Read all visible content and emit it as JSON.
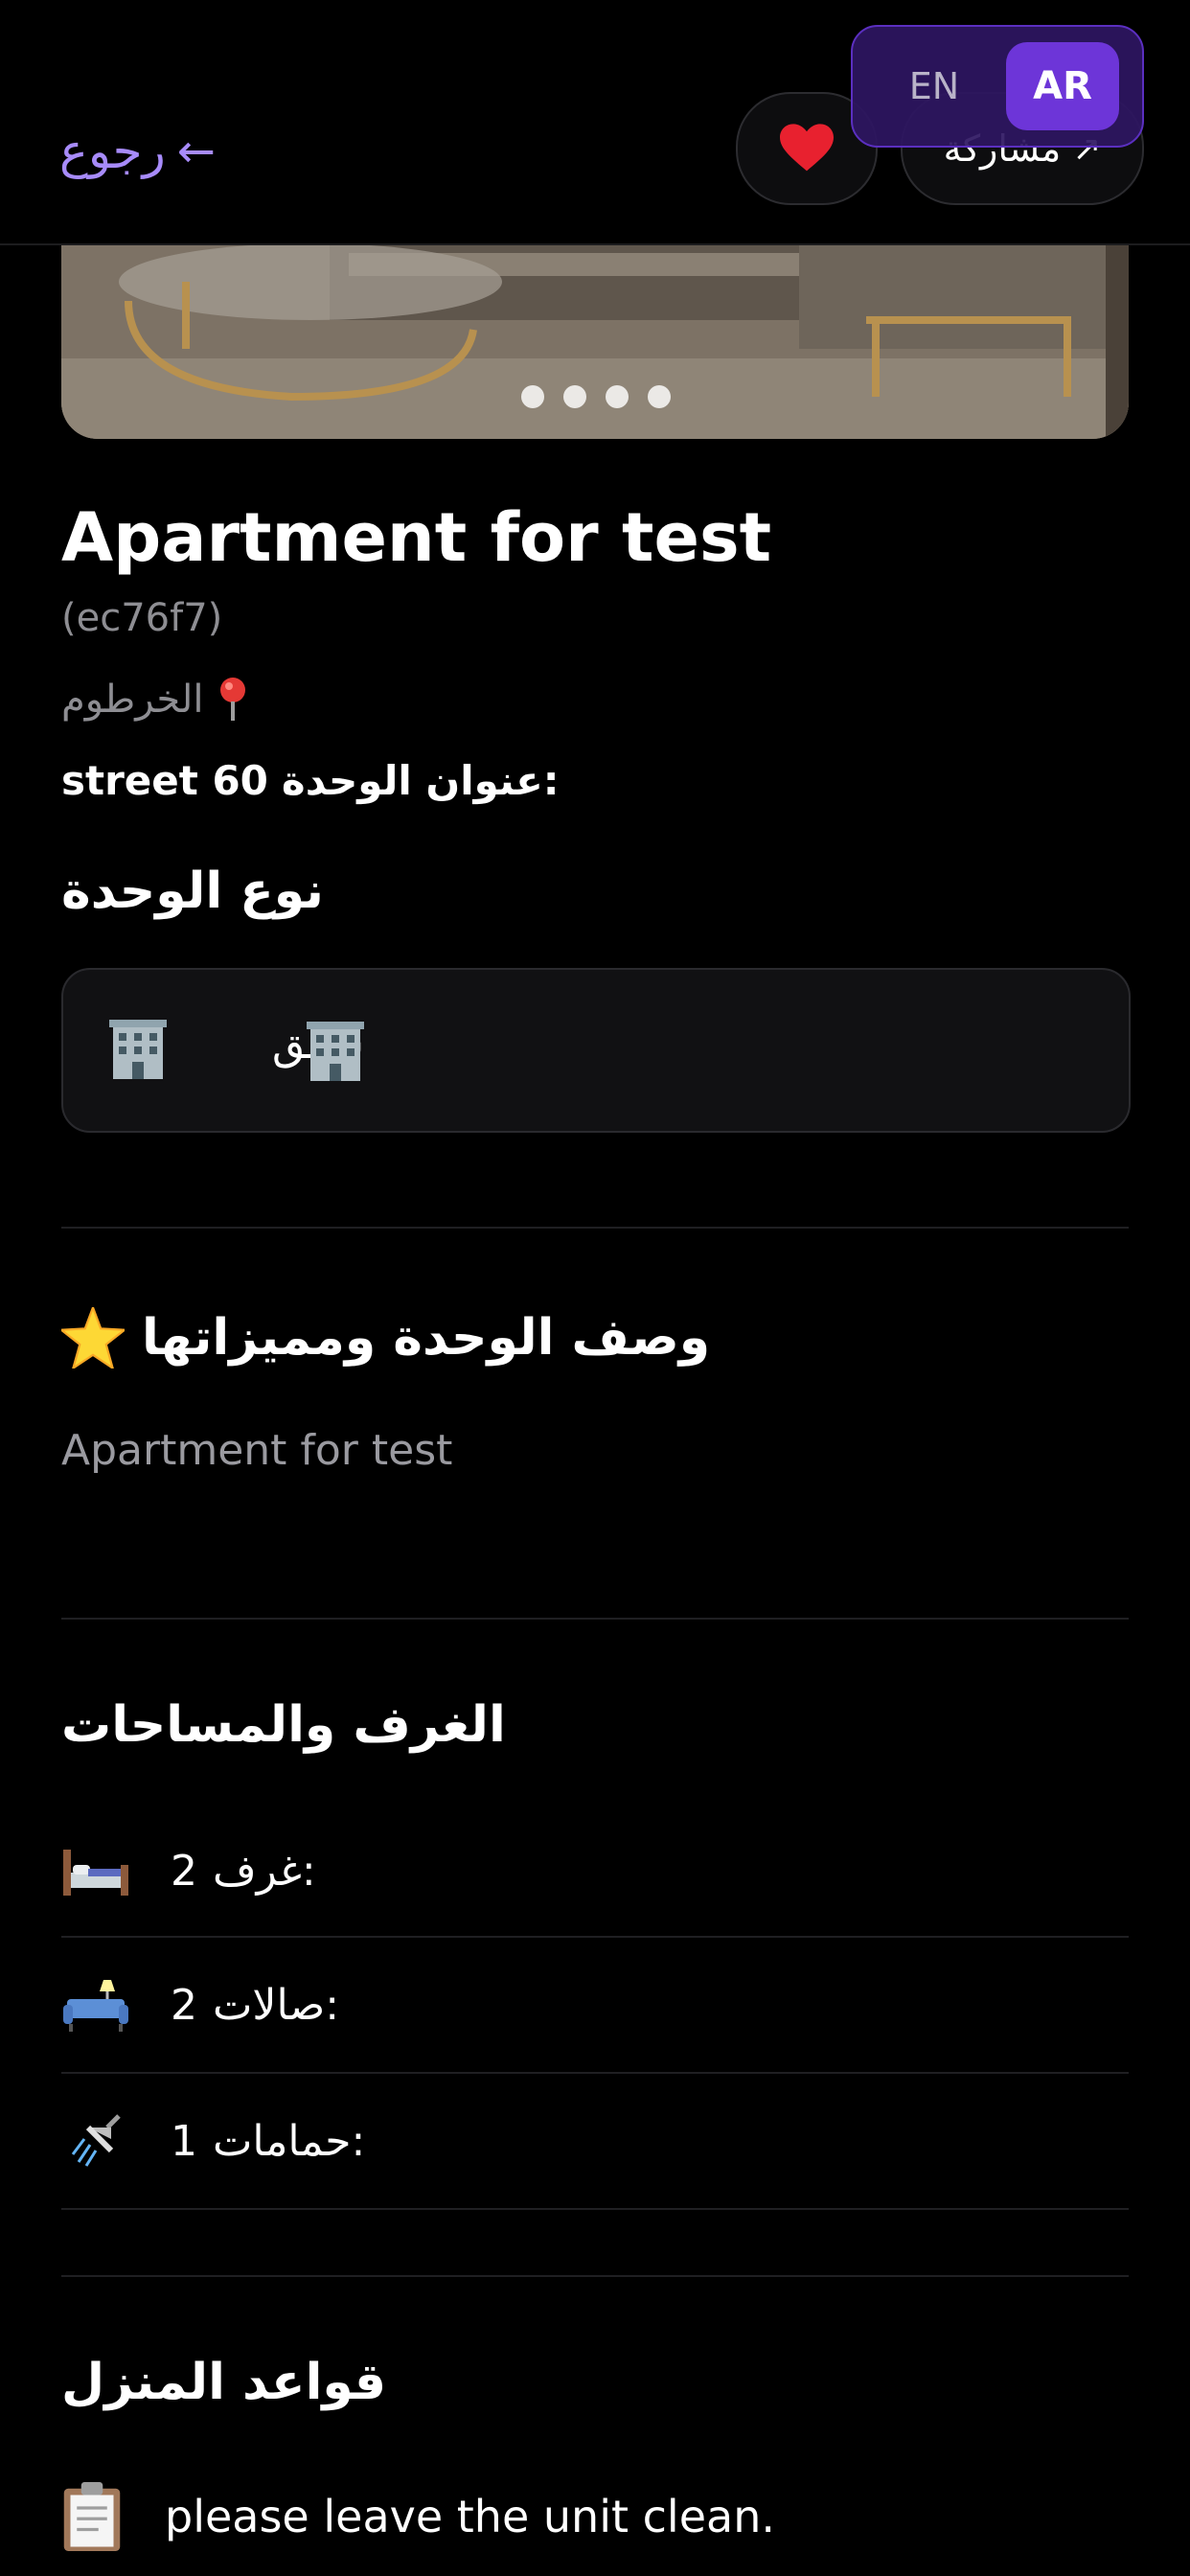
{
  "header": {
    "back_label": "رجوع",
    "share_label": "مشاركة",
    "favorite_icon": "heart-icon",
    "lang": {
      "en": "EN",
      "ar": "AR",
      "active": "AR"
    }
  },
  "gallery": {
    "image_count": 4
  },
  "listing": {
    "title": "Apartment for test",
    "code": "(ec76f7)",
    "location": "الخرطوم",
    "address_label": "عنوان الوحدة:",
    "address_value": "street 60"
  },
  "unit_type": {
    "heading": "نوع الوحدة",
    "value": "شقق"
  },
  "description": {
    "heading": "وصف الوحدة ومميزاتها",
    "text": "Apartment for test"
  },
  "rooms": {
    "heading": "الغرف والمساحات",
    "items": [
      {
        "icon": "bed-icon",
        "label": "غرف:",
        "value": "2"
      },
      {
        "icon": "sofa-icon",
        "label": "صالات:",
        "value": "2"
      },
      {
        "icon": "shower-icon",
        "label": "حمامات:",
        "value": "1"
      }
    ]
  },
  "rules": {
    "heading": "قواعد المنزل",
    "items": [
      {
        "icon": "clipboard-icon",
        "text": "please leave the unit clean."
      }
    ]
  },
  "colors": {
    "accent": "#6d35d8",
    "link": "#a78bfa",
    "background": "#000000"
  }
}
